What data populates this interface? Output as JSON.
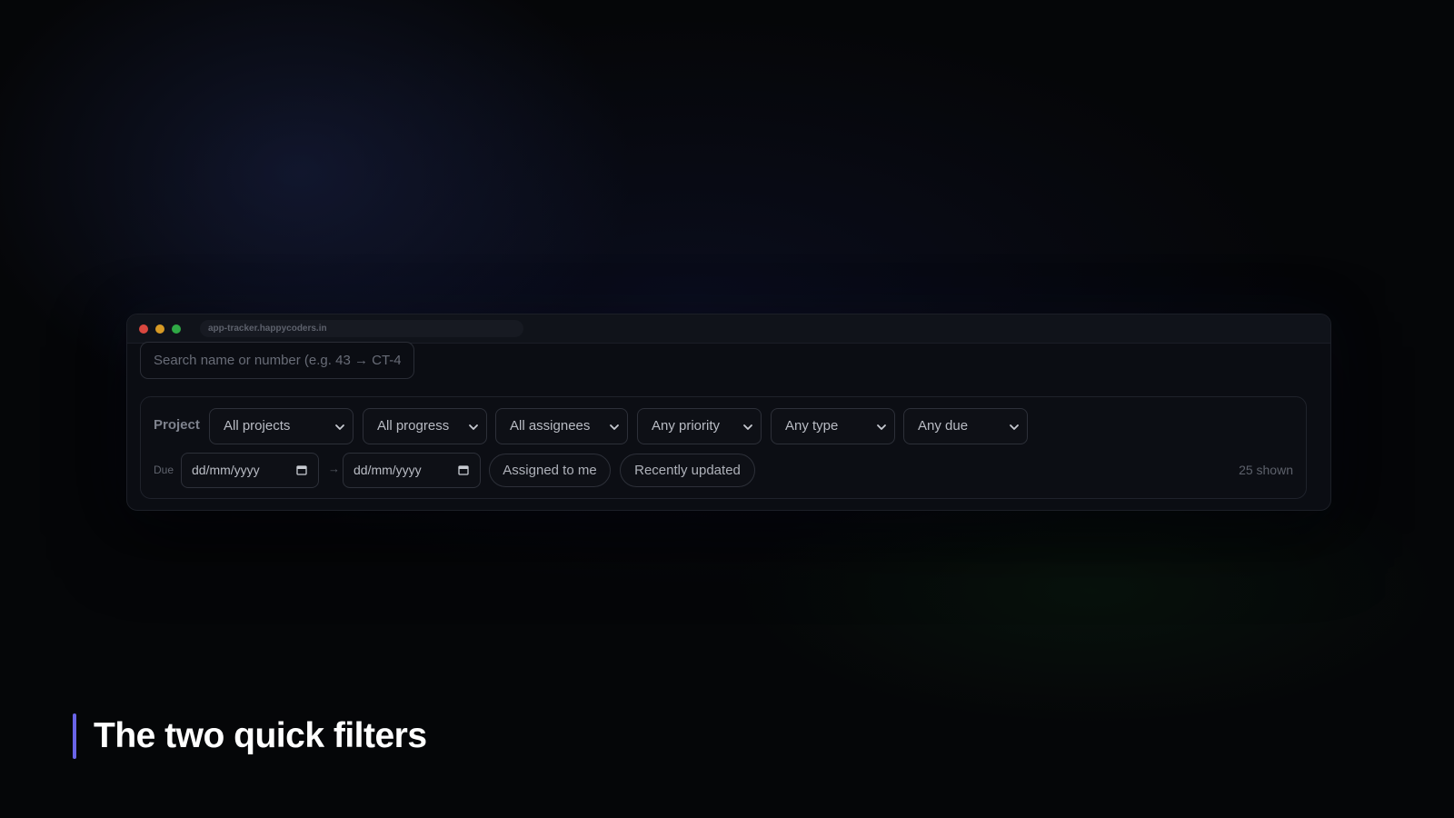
{
  "browser": {
    "url": "app-tracker.happycoders.in"
  },
  "search": {
    "placeholder": "Search name or number (e.g. 43 → CT-4"
  },
  "filters": {
    "project_label": "Project",
    "selects": [
      {
        "name": "project",
        "value": "All projects"
      },
      {
        "name": "progress",
        "value": "All progress"
      },
      {
        "name": "assignee",
        "value": "All assignees"
      },
      {
        "name": "priority",
        "value": "Any priority"
      },
      {
        "name": "type",
        "value": "Any type"
      },
      {
        "name": "due",
        "value": "Any due"
      }
    ],
    "due_label": "Due",
    "date_from": "dd/mm/yyyy",
    "date_arrow": "→",
    "date_to": "dd/mm/yyyy",
    "quick_filters": [
      "Assigned to me",
      "Recently updated"
    ],
    "count_text": "25 shown"
  },
  "caption": {
    "text": "The two quick filters",
    "accent_color": "#6a64e8"
  },
  "icons": {
    "select_chevron": "chevron-down-icon",
    "date_picker": "calendar-icon"
  }
}
